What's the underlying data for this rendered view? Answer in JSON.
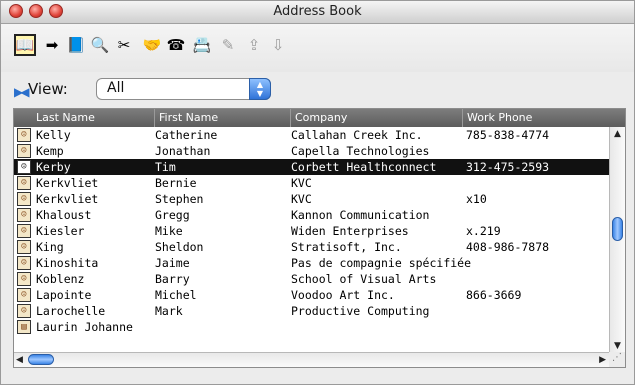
{
  "window": {
    "title": "Address Book"
  },
  "toolbar": {
    "icons": [
      {
        "name": "address-book-icon",
        "glyph": "📖"
      },
      {
        "name": "arrow-right-icon",
        "glyph": "➡"
      },
      {
        "name": "open-book-icon",
        "glyph": "📘"
      },
      {
        "name": "magnifier-icon",
        "glyph": "🔍"
      },
      {
        "name": "scissors-icon",
        "glyph": "✂"
      },
      {
        "name": "handshake-icon",
        "glyph": "🤝"
      },
      {
        "name": "phone-icon",
        "glyph": "☎"
      },
      {
        "name": "card-icon",
        "glyph": "📇"
      },
      {
        "name": "note-disabled-icon",
        "glyph": "✎"
      },
      {
        "name": "export-disabled-icon",
        "glyph": "⇪"
      },
      {
        "name": "import-disabled-icon",
        "glyph": "⇩"
      }
    ]
  },
  "view": {
    "label": "View:",
    "selected": "All"
  },
  "table": {
    "columns": [
      "Last Name",
      "First Name",
      "Company",
      "Work Phone"
    ],
    "rows": [
      {
        "last": "Kelly",
        "first": "Catherine",
        "company": "Callahan Creek Inc.",
        "phone": "785-838-4774",
        "selected": false,
        "icon": "person"
      },
      {
        "last": "Kemp",
        "first": "Jonathan",
        "company": "Capella Technologies",
        "phone": "",
        "selected": false,
        "icon": "person"
      },
      {
        "last": "Kerby",
        "first": "Tim",
        "company": "Corbett Healthconnect",
        "phone": "312-475-2593",
        "selected": true,
        "icon": "person"
      },
      {
        "last": "Kerkvliet",
        "first": "Bernie",
        "company": "KVC",
        "phone": "",
        "selected": false,
        "icon": "person"
      },
      {
        "last": "Kerkvliet",
        "first": "Stephen",
        "company": "KVC",
        "phone": "x10",
        "selected": false,
        "icon": "person"
      },
      {
        "last": "Khaloust",
        "first": "Gregg",
        "company": "Kannon Communication",
        "phone": "",
        "selected": false,
        "icon": "person"
      },
      {
        "last": "Kiesler",
        "first": "Mike",
        "company": "Widen Enterprises",
        "phone": "x.219",
        "selected": false,
        "icon": "person"
      },
      {
        "last": "King",
        "first": "Sheldon",
        "company": "Stratisoft, Inc.",
        "phone": "408-986-7878",
        "selected": false,
        "icon": "person"
      },
      {
        "last": "Kinoshita",
        "first": "Jaime",
        "company": "Pas de compagnie spécifiée",
        "phone": "",
        "selected": false,
        "icon": "person"
      },
      {
        "last": "Koblenz",
        "first": "Barry",
        "company": "School of Visual Arts",
        "phone": "",
        "selected": false,
        "icon": "person"
      },
      {
        "last": "Lapointe",
        "first": "Michel",
        "company": "Voodoo Art Inc.",
        "phone": "866-3669",
        "selected": false,
        "icon": "person"
      },
      {
        "last": "Larochelle",
        "first": "Mark",
        "company": "Productive Computing",
        "phone": "",
        "selected": false,
        "icon": "person"
      },
      {
        "last": "Laurin Johanne",
        "first": "",
        "company": "",
        "phone": "",
        "selected": false,
        "icon": "card"
      }
    ]
  }
}
